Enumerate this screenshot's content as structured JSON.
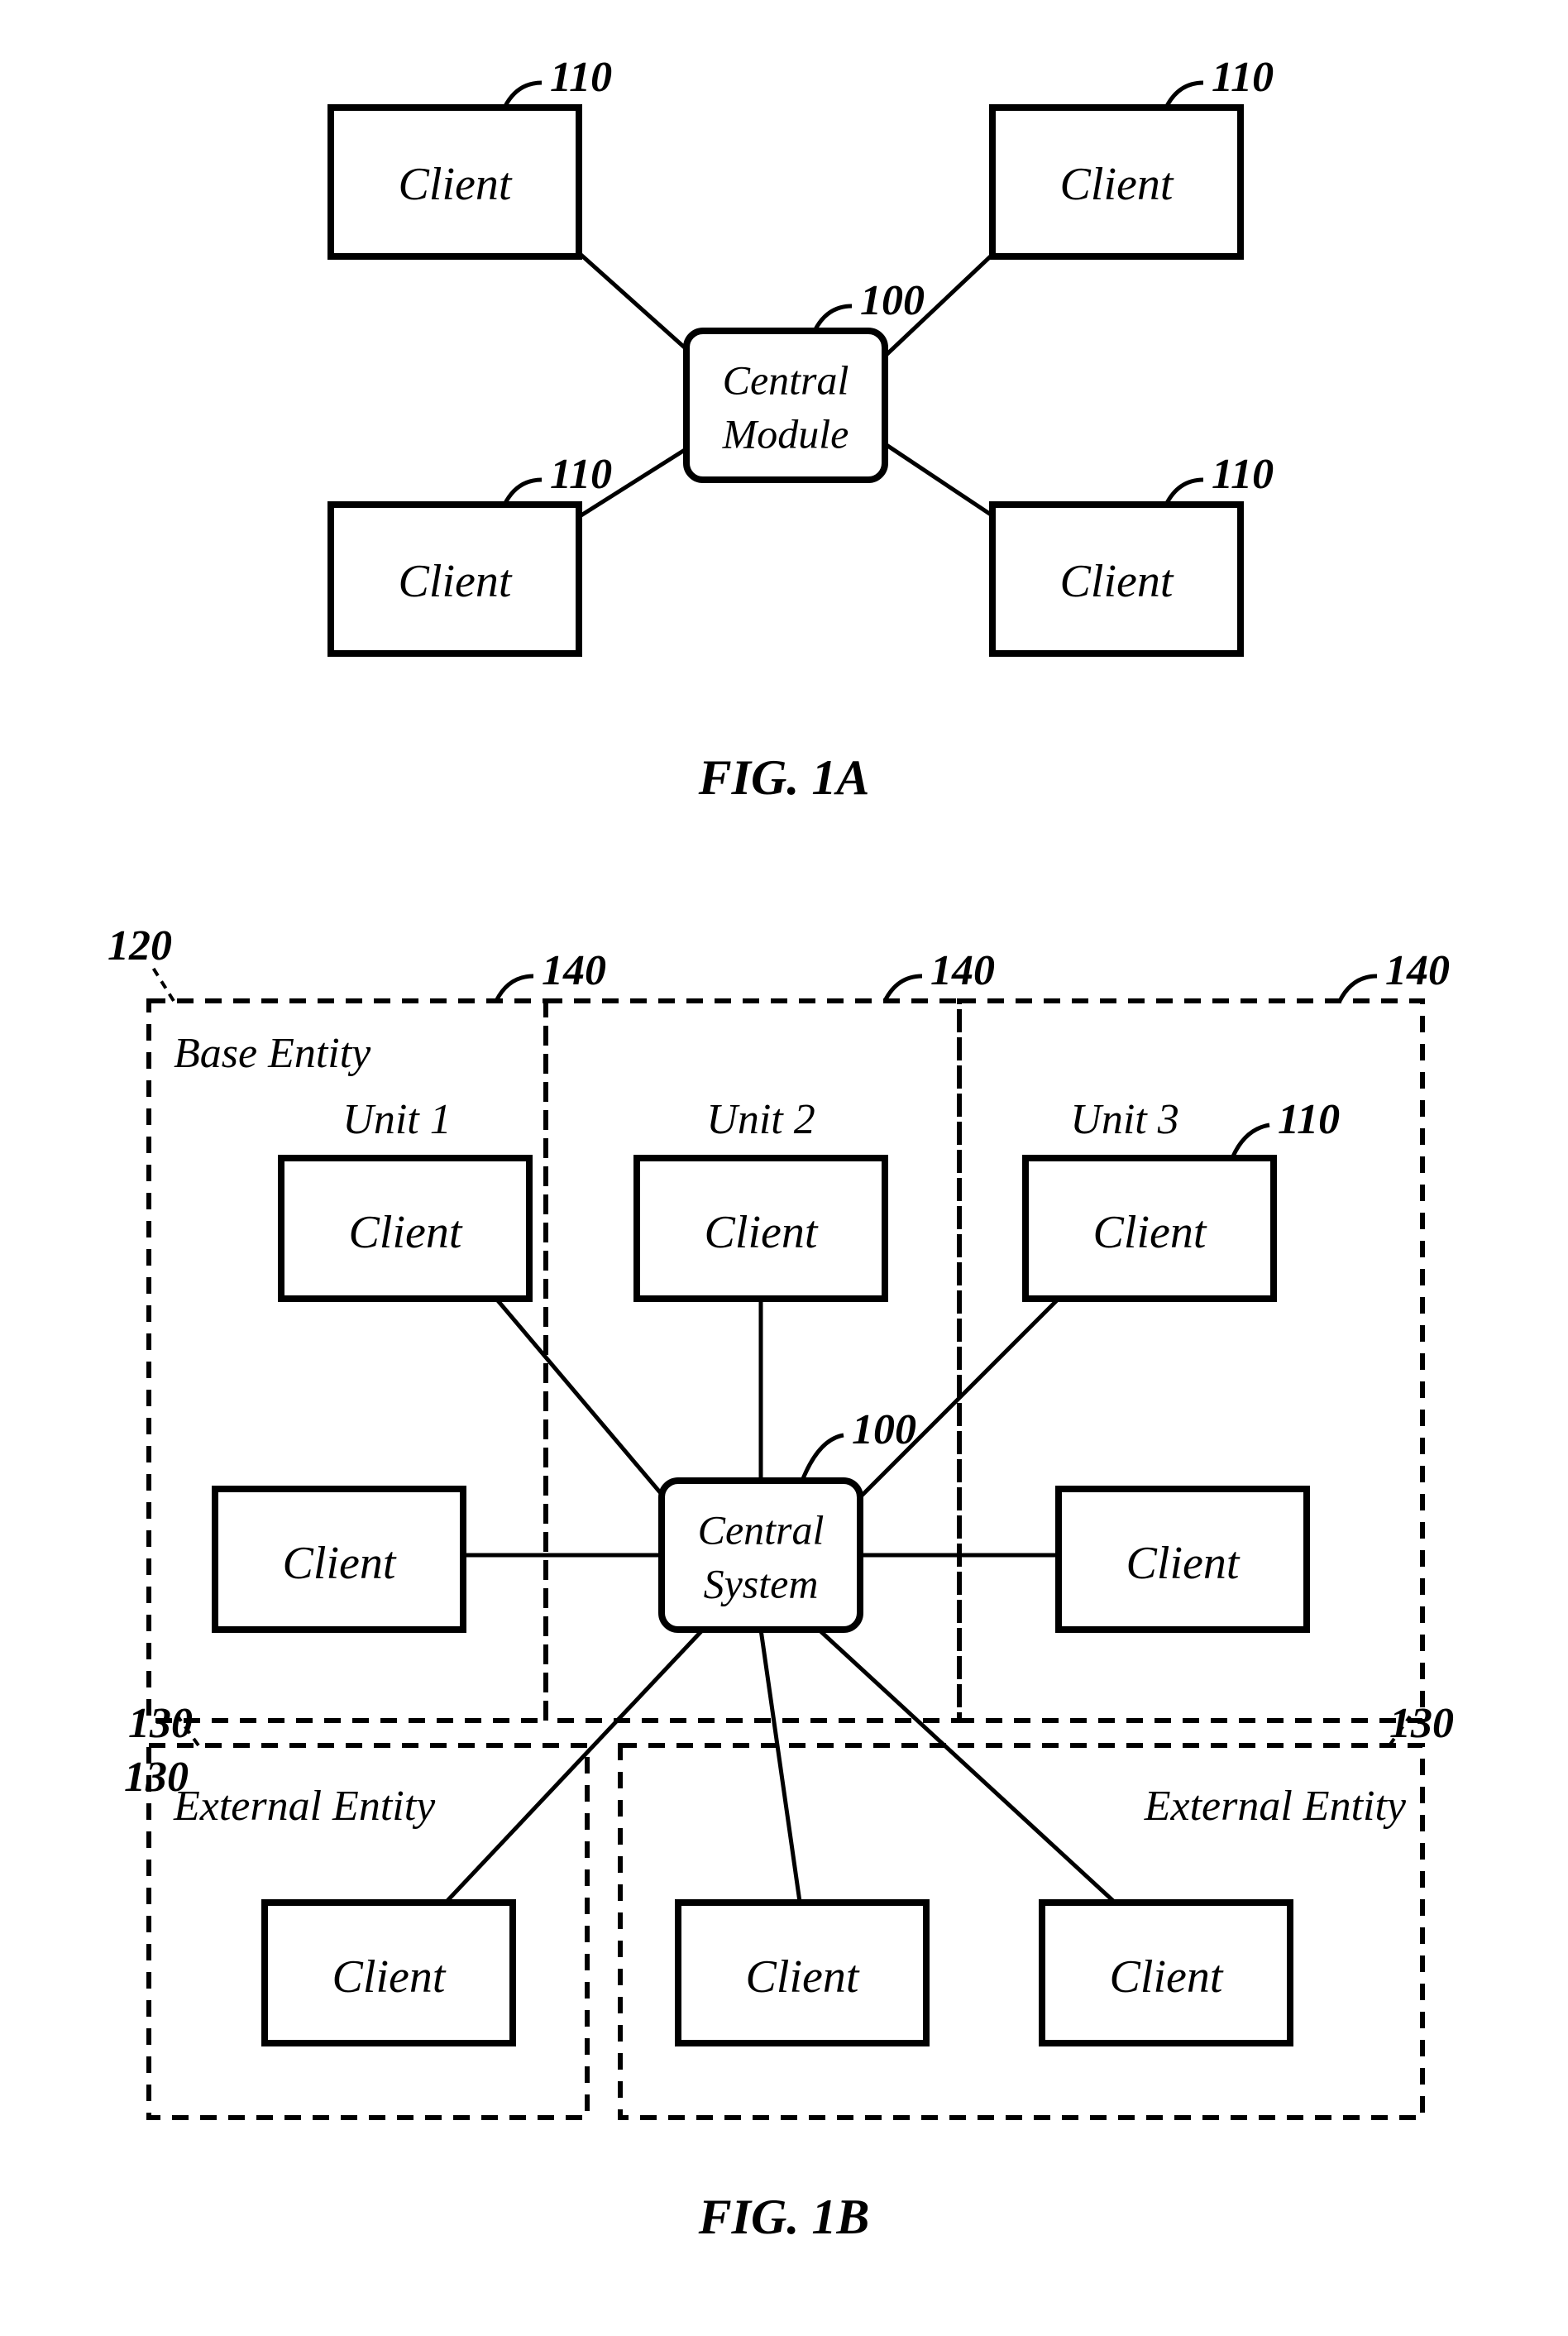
{
  "figA": {
    "caption": "FIG. 1A",
    "center": {
      "label_line1": "Central",
      "label_line2": "Module",
      "ref": "100"
    },
    "clients": {
      "tl": {
        "label": "Client",
        "ref": "110"
      },
      "tr": {
        "label": "Client",
        "ref": "110"
      },
      "bl": {
        "label": "Client",
        "ref": "110"
      },
      "br": {
        "label": "Client",
        "ref": "110"
      }
    }
  },
  "figB": {
    "caption": "FIG. 1B",
    "baseEntity": {
      "label": "Base Entity",
      "ref": "120"
    },
    "unit1": {
      "label": "Unit 1",
      "ref": "140"
    },
    "unit2": {
      "label": "Unit 2",
      "ref": "140"
    },
    "unit3": {
      "label": "Unit 3",
      "ref": "140"
    },
    "clientRef": "110",
    "center": {
      "label_line1": "Central",
      "label_line2": "System",
      "ref": "100"
    },
    "extLeft": {
      "label": "External Entity",
      "ref": "130"
    },
    "extRight": {
      "label": "External Entity",
      "ref": "130"
    },
    "clients": {
      "u1top": "Client",
      "u1bot": "Client",
      "u2top": "Client",
      "u3top": "Client",
      "u3bot": "Client",
      "el": "Client",
      "erL": "Client",
      "erR": "Client"
    }
  }
}
